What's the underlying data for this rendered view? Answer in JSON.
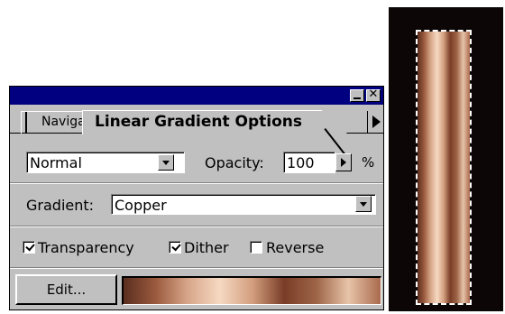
{
  "window": {
    "minimize_icon": "minimize-icon",
    "close_icon": "close-icon",
    "close_glyph": "✕",
    "titlebar_color": "#000080"
  },
  "tabs": {
    "navigator_label": "Navigator",
    "active_label": "Linear Gradient Options",
    "menu_icon": "triangle-right-icon"
  },
  "blend_mode": {
    "selected": "Normal"
  },
  "opacity": {
    "label": "Opacity:",
    "value": "100",
    "unit": "%"
  },
  "gradient": {
    "label": "Gradient:",
    "selected": "Copper",
    "colors": [
      "#5a2e1f",
      "#9b5a3e",
      "#d7a689",
      "#f6d9c2",
      "#d39f7f",
      "#7a3d27",
      "#9d6447",
      "#e7c4a9",
      "#a96a4d"
    ]
  },
  "options": {
    "transparency": {
      "label": "Transparency",
      "checked": true
    },
    "dither": {
      "label": "Dither",
      "checked": true
    },
    "reverse": {
      "label": "Reverse",
      "checked": false
    }
  },
  "edit_button": {
    "label": "Edit..."
  },
  "canvas": {
    "background": "#0c0606",
    "selection": "dashed-marquee"
  }
}
